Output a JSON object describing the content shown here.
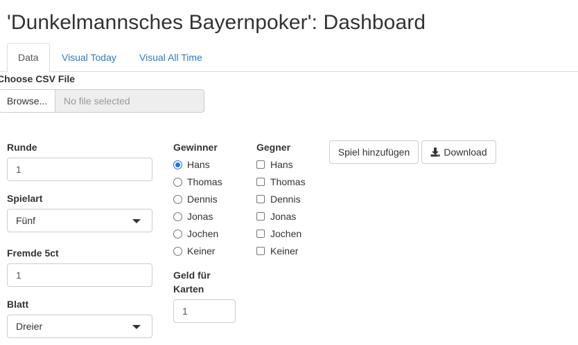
{
  "title": "'Dunkelmannsches Bayernpoker': Dashboard",
  "tabs": [
    {
      "label": "Data",
      "active": true
    },
    {
      "label": "Visual Today",
      "active": false
    },
    {
      "label": "Visual All Time",
      "active": false
    }
  ],
  "csv": {
    "label": "Choose CSV File",
    "browse_label": "Browse...",
    "placeholder": "No file selected"
  },
  "runde": {
    "label": "Runde",
    "value": "1"
  },
  "spielart": {
    "label": "Spielart",
    "selected": "Fünf"
  },
  "fremde": {
    "label": "Fremde 5ct",
    "value": "1"
  },
  "blatt": {
    "label": "Blatt",
    "selected": "Dreier"
  },
  "gewinner": {
    "label": "Gewinner",
    "options": [
      "Hans",
      "Thomas",
      "Dennis",
      "Jonas",
      "Jochen",
      "Keiner"
    ],
    "selected": "Hans"
  },
  "geld": {
    "label_line1": "Geld für",
    "label_line2": "Karten",
    "value": "1"
  },
  "gegner": {
    "label": "Gegner",
    "options": [
      "Hans",
      "Thomas",
      "Dennis",
      "Jonas",
      "Jochen",
      "Keiner"
    ]
  },
  "actions": {
    "add_label": "Spiel hinzufügen",
    "download_label": "Download",
    "download_icon": "download-icon"
  }
}
